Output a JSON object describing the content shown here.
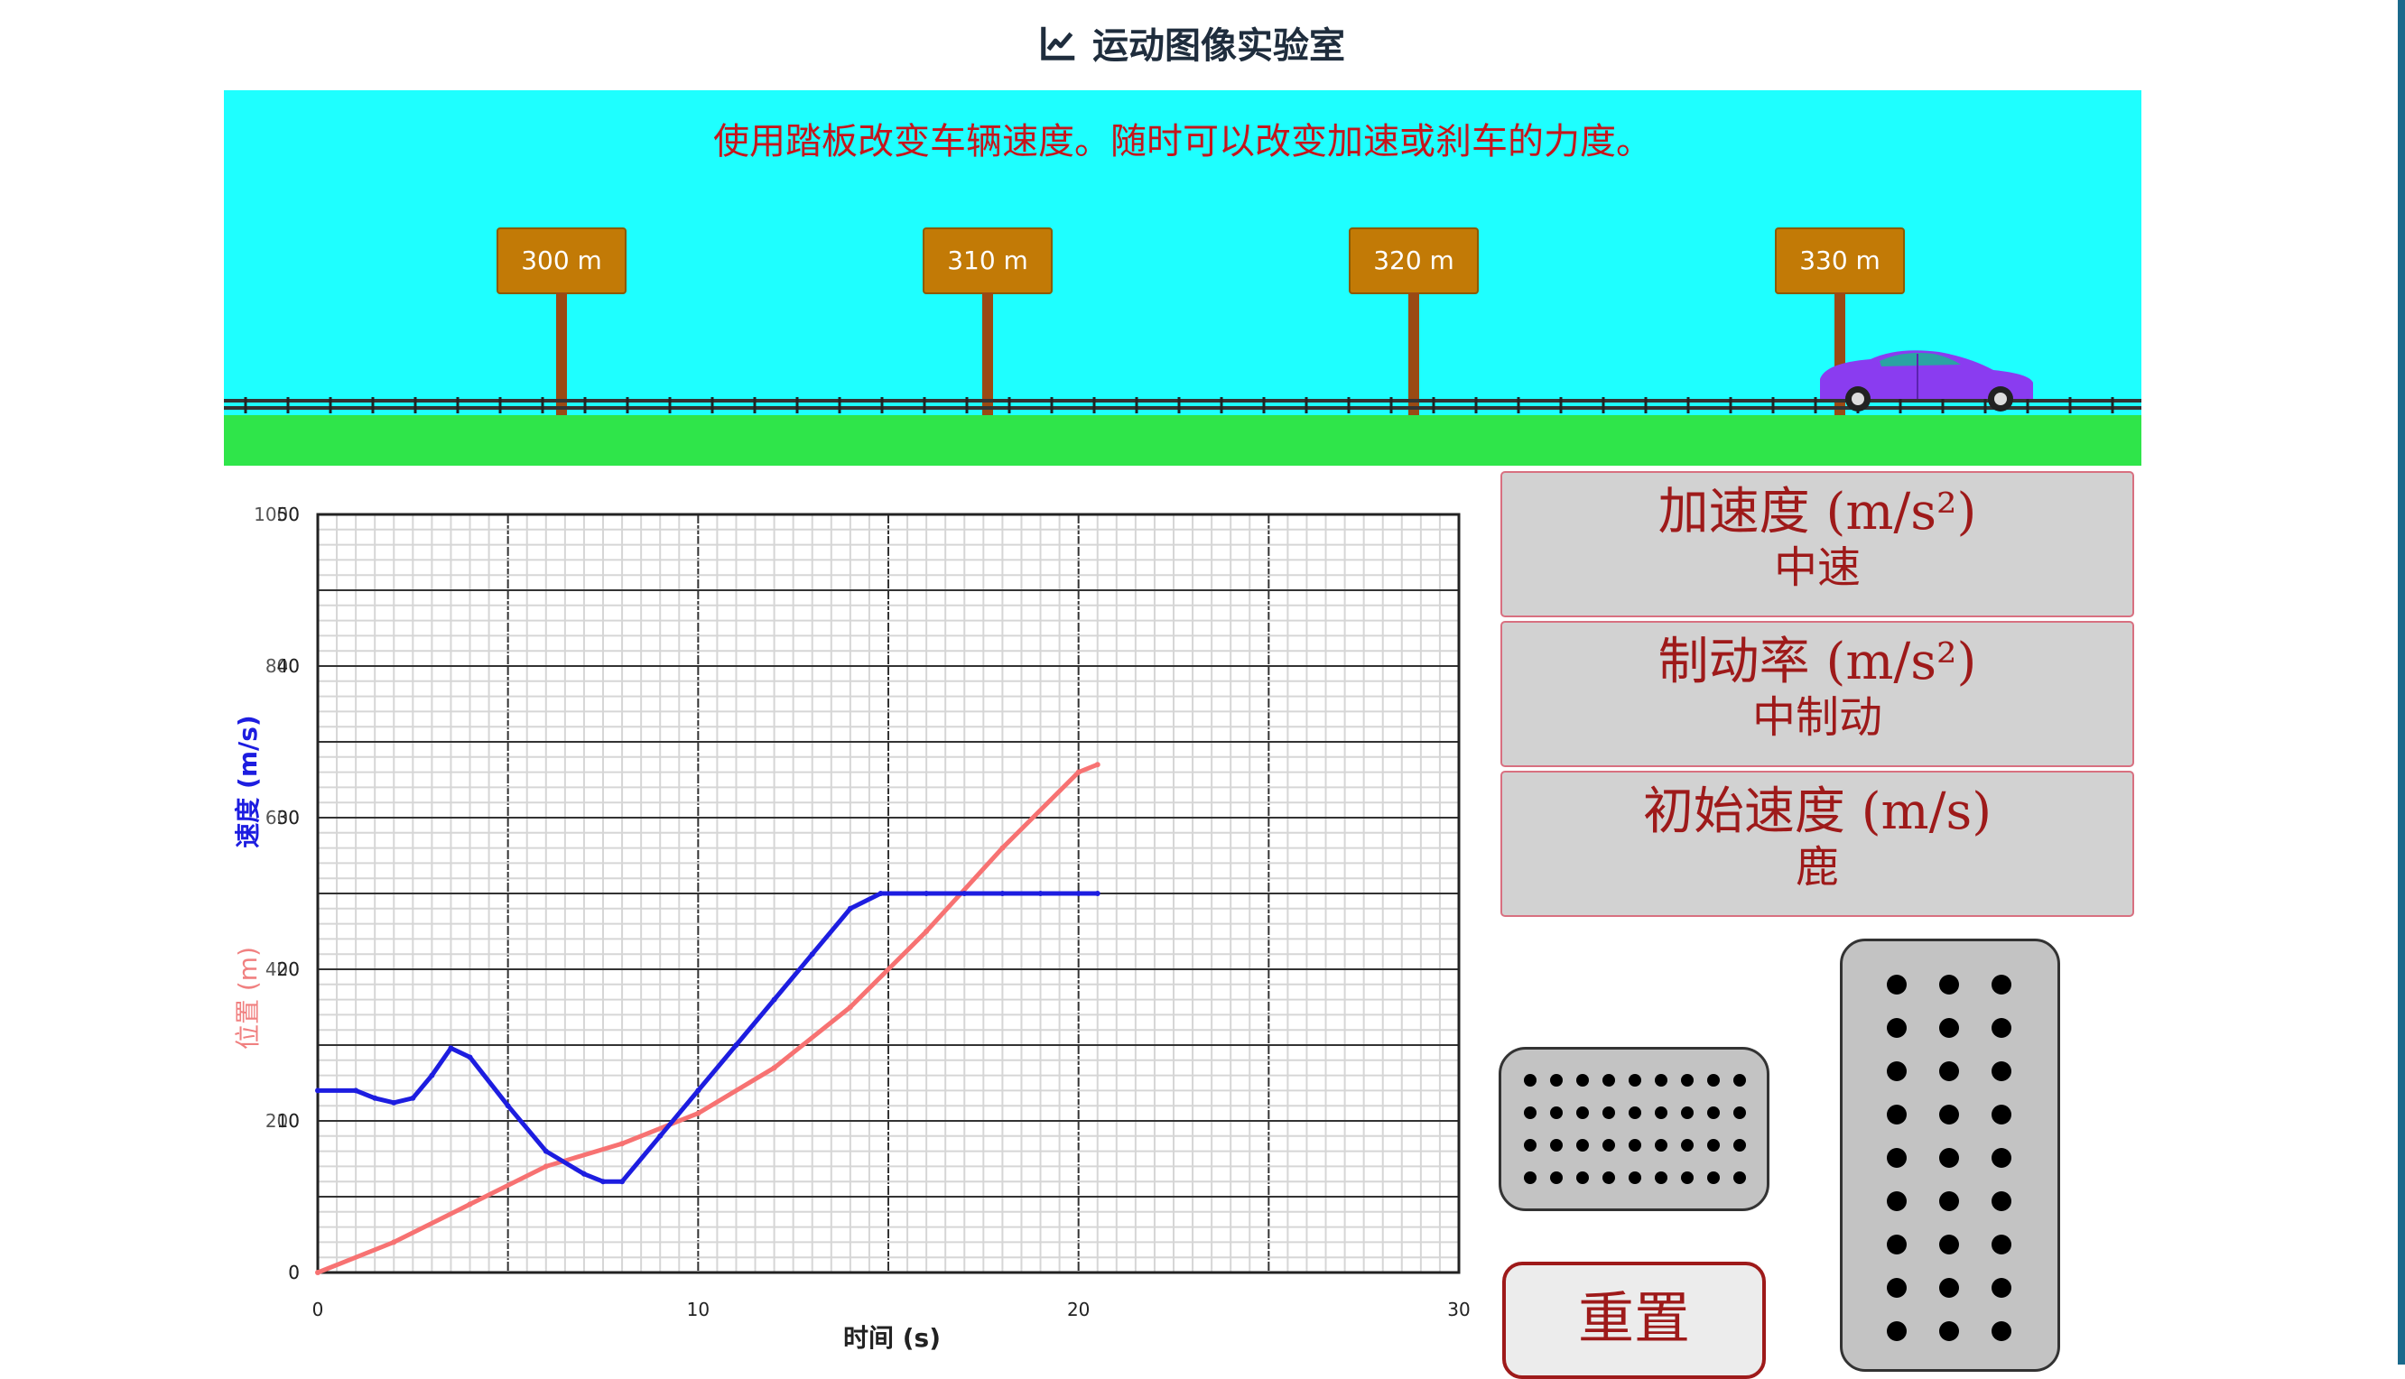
{
  "header": {
    "title": "运动图像实验室",
    "icon": "line-chart-icon"
  },
  "simulation": {
    "instruction": "使用踏板改变车辆速度。随时可以改变加速或刹车的力度。",
    "signs": [
      "300 m",
      "310 m",
      "320 m",
      "330 m"
    ],
    "colors": {
      "sky": "#1effff",
      "grass": "#2fe54a",
      "sign": "#c27a06",
      "car": "#8a3cf0"
    }
  },
  "chart_data": {
    "type": "line",
    "xlabel": "时间 (s)",
    "ylabel_velocity": "速度 (m/s)",
    "ylabel_position": "位置 (m)",
    "xlim": [
      0,
      30
    ],
    "x_ticks": [
      "0",
      "10",
      "20",
      "30"
    ],
    "velocity_axis": {
      "ylim": [
        0,
        50
      ],
      "ticks": [
        "0",
        "10",
        "20",
        "30",
        "40",
        "50"
      ]
    },
    "position_axis": {
      "ylim": [
        0,
        1000
      ],
      "ticks": [
        "0",
        "200",
        "400",
        "600",
        "800",
        "1000"
      ]
    },
    "grid": true,
    "series": [
      {
        "name": "速度 (m/s)",
        "color": "#1d1de0",
        "axis": "velocity",
        "x": [
          0,
          1,
          1.5,
          2,
          2.5,
          3,
          3.5,
          4,
          5,
          6,
          7,
          7.5,
          8,
          9,
          10,
          11,
          12,
          13,
          14,
          14.8,
          16,
          17,
          18,
          19,
          20,
          20.5
        ],
        "y": [
          12,
          12,
          11.5,
          11.2,
          11.5,
          13,
          14.8,
          14.2,
          11,
          8,
          6.5,
          6,
          6,
          9,
          12,
          15,
          18,
          21,
          24,
          25,
          25,
          25,
          25,
          25,
          25,
          25
        ]
      },
      {
        "name": "位置 (m)",
        "color": "#f77272",
        "axis": "position",
        "x": [
          0,
          2,
          4,
          6,
          8,
          10,
          12,
          14,
          16,
          18,
          20,
          20.5
        ],
        "y": [
          0,
          40,
          90,
          140,
          170,
          210,
          270,
          350,
          450,
          560,
          660,
          670
        ]
      }
    ]
  },
  "controls": {
    "acceleration": {
      "title": "加速度 (m/s²)",
      "value": "中速"
    },
    "braking": {
      "title": "制动率 (m/s²)",
      "value": "中制动"
    },
    "initial_speed": {
      "title": "初始速度 (m/s)",
      "value": "鹿"
    },
    "reset": "重置"
  }
}
